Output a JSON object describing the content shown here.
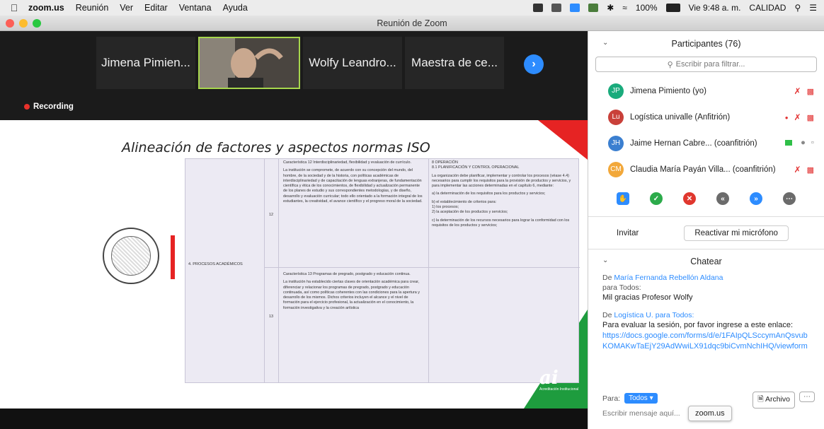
{
  "menubar": {
    "app": "zoom.us",
    "items": [
      "Reunión",
      "Ver",
      "Editar",
      "Ventana",
      "Ayuda"
    ],
    "battery": "100%",
    "clock": "Vie 9:48 a. m.",
    "user": "CALIDAD"
  },
  "window": {
    "title": "Reunión de Zoom"
  },
  "thumbs": [
    {
      "label": "Jimena Pimien..."
    },
    {
      "label": ""
    },
    {
      "label": "Wolfy Leandro..."
    },
    {
      "label": "Maestra de ce..."
    }
  ],
  "recording": "Recording",
  "slide": {
    "title": "Alineación de factores y aspectos normas ISO",
    "factor": "4. PROCESOS ACADÉMICOS",
    "row12_num": "12",
    "row13_num": "13",
    "c12_title": "Característica 12 Interdisciplinariedad, flexibilidad y evaluación de currículo.",
    "c12_text": "La institución se compromete, de acuerdo con su concepción del mundo, del hombre, de la sociedad y de la historia, con políticas académicas de interdisciplinariedad y de capacitación de lenguas extranjeras, de fundamentación científica y ética de los conocimientos, de flexibilidad y actualización permanente de los planes de estudio y sus correspondientes metodologías, y de diseño, desarrollo y evaluación curricular; todo ello orientado a la formación integral de los estudiantes, la creatividad, el avance científico y el progreso moral de la sociedad.",
    "c13_title": "Característica 13 Programas de pregrado, postgrado y educación continua.",
    "c13_text": "La institución ha establecido ciertas claves de orientación académica para crear, diferenciar y relacionar los programas de pregrado, postgrado y educación continuada, así como políticas coherentes con las condiciones para la apertura y desarrollo de los mismos. Dichos criterios incluyen el alcance y el nivel de formación para el ejercicio profesional, la actualización en el conocimiento, la formación investigativa y la creación artística",
    "iso_head": "8 OPERACIÓN\n8.1 PLANIFICACIÓN Y CONTROL OPERACIONAL",
    "iso_p1": "La organización debe planificar, implementar y controlar los procesos (véase 4.4) necesarios para cumplir los requisitos para la provisión de productos y servicios, y para implementar las acciones determinadas en el capítulo 6, mediante:",
    "iso_p2": "a) la determinación de los requisitos para los productos y servicios;",
    "iso_p3": "b) el establecimiento de criterios para:\n1) los procesos;\n2) la aceptación de los productos y servicios;",
    "iso_p4": "c) la determinación de los recursos necesarios para lograr la conformidad con los requisitos de los productos y servicios;",
    "logo_mark": "ai",
    "logo_text": "Acreditación Institucional"
  },
  "participants": {
    "header": "Participantes (76)",
    "search_placeholder": "Escribir para filtrar...",
    "list": [
      {
        "initials": "JP",
        "name": "Jimena Pimiento (yo)",
        "color": "#1aab7c"
      },
      {
        "initials": "Lu",
        "name": "Logística univalle (Anfitrión)",
        "color": "#c9403a"
      },
      {
        "initials": "JH",
        "name": "Jaime Hernan Cabre...  (coanfitrión)",
        "color": "#3b7fd0"
      },
      {
        "initials": "CM",
        "name": "Claudia María Payán Villa...  (coanfitrión)",
        "color": "#f2a83a"
      }
    ],
    "invite": "Invitar",
    "unmute": "Reactivar mi micrófono"
  },
  "chat": {
    "header": "Chatear",
    "messages": [
      {
        "from_prefix": "De",
        "from": "María Fernanda Rebellón Aldana",
        "to": "para Todos:",
        "text": "Mil gracias Profesor Wolfy"
      },
      {
        "from_prefix": "De",
        "from": "Logística U.",
        "to": "para Todos:",
        "text": "Para evaluar la sesión, por favor ingrese a este enlace:",
        "link": "https://docs.google.com/forms/d/e/1FAIpQLSccymAnQsvubKOMAKwTaEjY29AdWwiLX91dqc9biCvmNchIHQ/viewform"
      }
    ],
    "to_label": "Para:",
    "to_value": "Todos",
    "file_btn": "Archivo",
    "input_placeholder": "Escribir mensaje aquí..."
  },
  "tooltip": "zoom.us"
}
